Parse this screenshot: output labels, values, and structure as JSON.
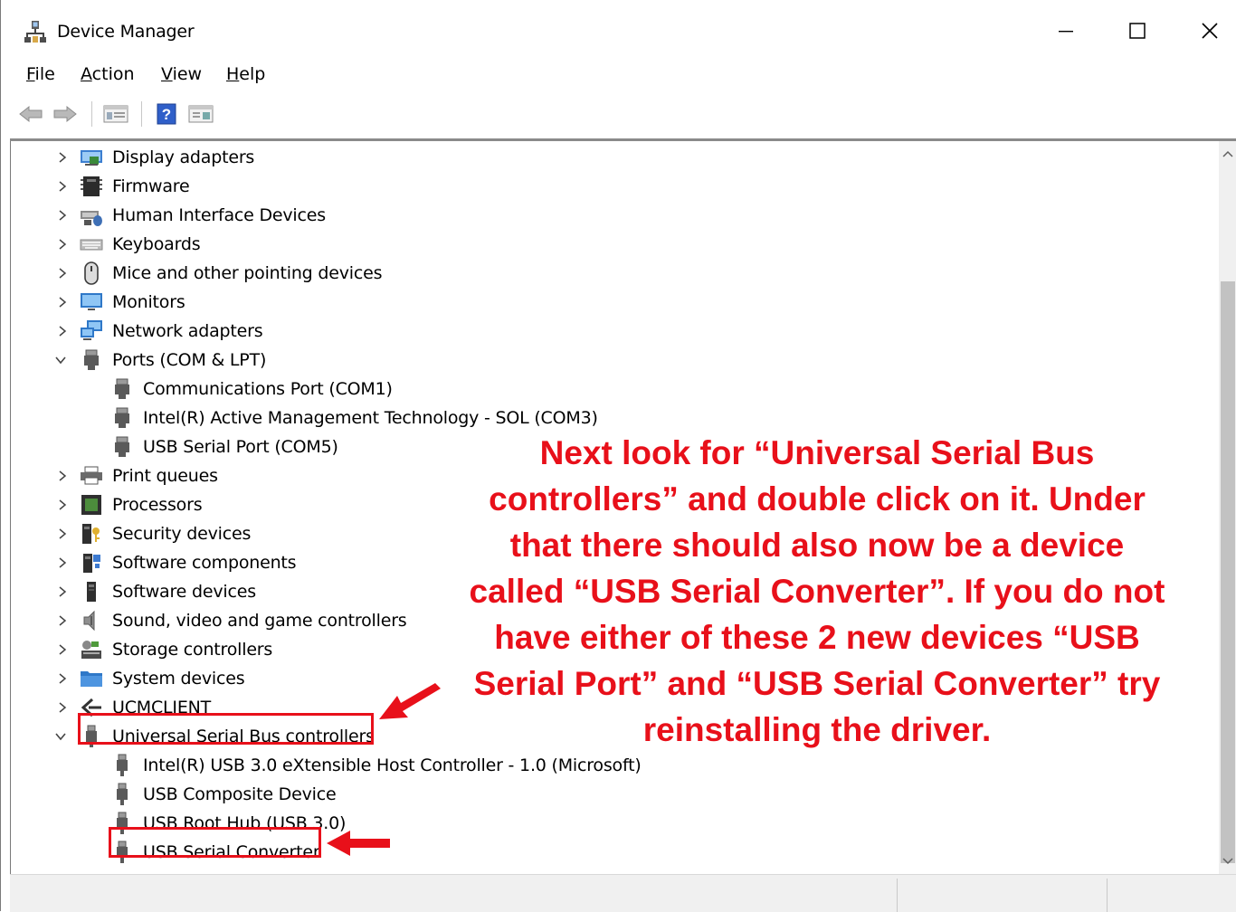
{
  "window": {
    "title": "Device Manager",
    "controls": {
      "minimize": "minimize",
      "maximize": "maximize",
      "close": "close"
    }
  },
  "menu": [
    {
      "label": "File",
      "access_key": "F",
      "rest": "ile"
    },
    {
      "label": "Action",
      "access_key": "A",
      "rest": "ction"
    },
    {
      "label": "View",
      "access_key": "V",
      "rest": "iew"
    },
    {
      "label": "Help",
      "access_key": "H",
      "rest": "elp"
    }
  ],
  "toolbar": {
    "buttons": [
      "back-arrow-icon",
      "forward-arrow-icon",
      "properties-icon",
      "help-icon",
      "update-driver-icon"
    ]
  },
  "tree": {
    "items": [
      {
        "label": "Display adapters",
        "level": 0,
        "expanded": false,
        "icon": "display-adapter-icon"
      },
      {
        "label": "Firmware",
        "level": 0,
        "expanded": false,
        "icon": "firmware-icon"
      },
      {
        "label": "Human Interface Devices",
        "level": 0,
        "expanded": false,
        "icon": "hid-icon"
      },
      {
        "label": "Keyboards",
        "level": 0,
        "expanded": false,
        "icon": "keyboard-icon"
      },
      {
        "label": "Mice and other pointing devices",
        "level": 0,
        "expanded": false,
        "icon": "mouse-icon"
      },
      {
        "label": "Monitors",
        "level": 0,
        "expanded": false,
        "icon": "monitor-icon"
      },
      {
        "label": "Network adapters",
        "level": 0,
        "expanded": false,
        "icon": "network-icon"
      },
      {
        "label": "Ports (COM & LPT)",
        "level": 0,
        "expanded": true,
        "icon": "port-icon"
      },
      {
        "label": "Communications Port (COM1)",
        "level": 1,
        "icon": "port-icon"
      },
      {
        "label": "Intel(R) Active Management Technology - SOL (COM3)",
        "level": 1,
        "icon": "port-icon"
      },
      {
        "label": "USB Serial Port (COM5)",
        "level": 1,
        "icon": "port-icon"
      },
      {
        "label": "Print queues",
        "level": 0,
        "expanded": false,
        "icon": "printer-icon"
      },
      {
        "label": "Processors",
        "level": 0,
        "expanded": false,
        "icon": "processor-icon"
      },
      {
        "label": "Security devices",
        "level": 0,
        "expanded": false,
        "icon": "security-icon"
      },
      {
        "label": "Software components",
        "level": 0,
        "expanded": false,
        "icon": "software-component-icon"
      },
      {
        "label": "Software devices",
        "level": 0,
        "expanded": false,
        "icon": "software-device-icon"
      },
      {
        "label": "Sound, video and game controllers",
        "level": 0,
        "expanded": false,
        "icon": "speaker-icon"
      },
      {
        "label": "Storage controllers",
        "level": 0,
        "expanded": false,
        "icon": "storage-icon"
      },
      {
        "label": "System devices",
        "level": 0,
        "expanded": false,
        "icon": "system-folder-icon"
      },
      {
        "label": "UCMCLIENT",
        "level": 0,
        "expanded": false,
        "icon": "ucm-icon"
      },
      {
        "label": "Universal Serial Bus controllers",
        "level": 0,
        "expanded": true,
        "icon": "usb-icon",
        "highlighted": true
      },
      {
        "label": "Intel(R) USB 3.0 eXtensible Host Controller - 1.0 (Microsoft)",
        "level": 1,
        "icon": "usb-icon"
      },
      {
        "label": "USB Composite Device",
        "level": 1,
        "icon": "usb-icon"
      },
      {
        "label": "USB Root Hub (USB 3.0)",
        "level": 1,
        "icon": "usb-icon"
      },
      {
        "label": "USB Serial Converter",
        "level": 1,
        "icon": "usb-icon",
        "highlighted": true
      }
    ]
  },
  "annotation": {
    "text": "Next look for “Universal Serial Bus controllers” and double click on it. Under that there should also now be a device called “USB Serial Converter”. If you do not have either of these 2 new devices “USB Serial Port” and “USB Serial Converter” try reinstalling the driver.",
    "color": "#e8101a"
  },
  "colors": {
    "highlight": "#e8101a",
    "status_bar": "#f0f0f0",
    "scroll_thumb": "#c2c2c2"
  }
}
